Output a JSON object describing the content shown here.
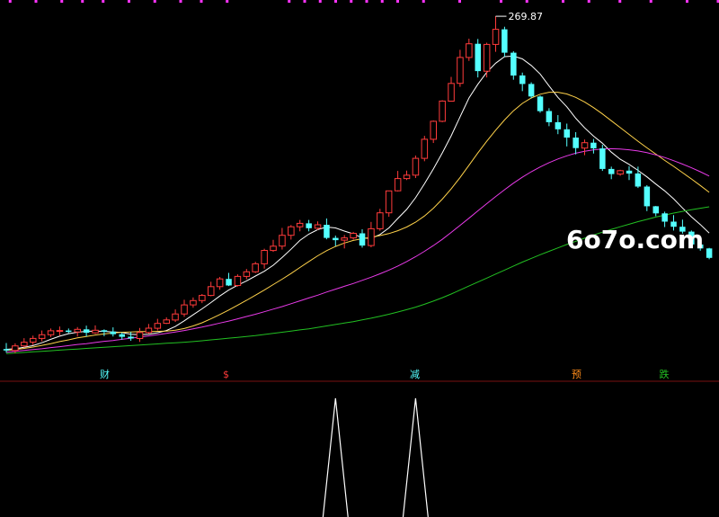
{
  "chart_data": {
    "type": "candlestick",
    "colors": {
      "up": "#ff3b3b",
      "down": "#54ffff",
      "background": "#000000",
      "ma5": "#ffffff",
      "ma10": "#ffd24a",
      "ma30": "#e83ae8",
      "ma60": "#22c022",
      "divider": "#7a1010",
      "top_markers": "#ff33ff",
      "indicator": "#ffffff"
    },
    "y_range": [
      150,
      274
    ],
    "peak": {
      "label": "269.87",
      "value": 269.87,
      "index": 55
    },
    "candles": [
      [
        153.1,
        152.6,
        155.2,
        151.8
      ],
      [
        152.6,
        154.2,
        155.1,
        151.7
      ],
      [
        154.2,
        155.5,
        156.9,
        153.7
      ],
      [
        155.5,
        156.8,
        157.8,
        154.5
      ],
      [
        156.8,
        158.1,
        159.6,
        155.8
      ],
      [
        158.1,
        159.5,
        160.3,
        157.3
      ],
      [
        159.5,
        159.6,
        161.0,
        157.9
      ],
      [
        159.6,
        159.1,
        160.3,
        158.7
      ],
      [
        159.1,
        160.0,
        160.8,
        157.5
      ],
      [
        160.0,
        158.8,
        161.3,
        157.5
      ],
      [
        158.8,
        159.7,
        161.4,
        158.4
      ],
      [
        159.7,
        159.2,
        160.0,
        157.6
      ],
      [
        159.2,
        158.3,
        160.7,
        157.5
      ],
      [
        158.3,
        157.4,
        158.9,
        156.4
      ],
      [
        157.4,
        156.8,
        159.1,
        156.0
      ],
      [
        156.8,
        158.9,
        160.5,
        155.6
      ],
      [
        158.9,
        160.4,
        161.9,
        158.4
      ],
      [
        160.4,
        162.1,
        163.7,
        159.6
      ],
      [
        162.1,
        163.3,
        164.2,
        161.9
      ],
      [
        163.3,
        165.4,
        167.0,
        162.6
      ],
      [
        165.4,
        168.6,
        170.4,
        164.4
      ],
      [
        168.6,
        170.1,
        171.2,
        167.6
      ],
      [
        170.1,
        171.9,
        172.4,
        169.2
      ],
      [
        171.9,
        175.0,
        176.7,
        171.6
      ],
      [
        175.0,
        177.7,
        178.4,
        173.9
      ],
      [
        177.7,
        175.4,
        179.8,
        175.2
      ],
      [
        175.4,
        178.6,
        179.3,
        175.0
      ],
      [
        178.6,
        180.2,
        181.2,
        177.6
      ],
      [
        180.2,
        183.0,
        183.7,
        179.8
      ],
      [
        183.0,
        187.7,
        188.3,
        181.3
      ],
      [
        187.7,
        189.2,
        191.4,
        187.2
      ],
      [
        189.2,
        193.0,
        195.6,
        188.0
      ],
      [
        193.0,
        196.0,
        196.6,
        191.5
      ],
      [
        196.0,
        197.2,
        198.4,
        194.4
      ],
      [
        197.2,
        195.5,
        198.4,
        194.4
      ],
      [
        195.5,
        196.7,
        197.9,
        194.9
      ],
      [
        196.7,
        192.1,
        198.9,
        191.6
      ],
      [
        192.1,
        191.3,
        192.9,
        189.2
      ],
      [
        191.3,
        192.1,
        193.1,
        188.4
      ],
      [
        192.1,
        193.7,
        194.2,
        191.5
      ],
      [
        193.7,
        189.4,
        195.1,
        188.7
      ],
      [
        189.4,
        195.3,
        197.7,
        188.8
      ],
      [
        195.3,
        200.9,
        202.3,
        194.6
      ],
      [
        200.9,
        208.6,
        208.7,
        199.5
      ],
      [
        208.6,
        212.9,
        215.6,
        208.4
      ],
      [
        212.9,
        214.1,
        215.7,
        212.4
      ],
      [
        214.1,
        220.0,
        221.0,
        213.1
      ],
      [
        220.0,
        226.7,
        227.9,
        219.0
      ],
      [
        226.7,
        233.0,
        233.3,
        225.4
      ],
      [
        233.0,
        240.1,
        240.4,
        232.7
      ],
      [
        240.1,
        246.3,
        248.6,
        240.1
      ],
      [
        246.3,
        255.4,
        258.1,
        245.1
      ],
      [
        255.4,
        260.2,
        262.0,
        254.2
      ],
      [
        260.2,
        250.6,
        261.9,
        248.4
      ],
      [
        250.6,
        260.0,
        260.6,
        248.4
      ],
      [
        260.0,
        265.3,
        269.9,
        257.4
      ],
      [
        265.3,
        257.1,
        266.2,
        255.7
      ],
      [
        257.1,
        249.1,
        257.6,
        247.6
      ],
      [
        249.1,
        246.1,
        250.1,
        243.6
      ],
      [
        246.1,
        241.7,
        246.7,
        241.1
      ],
      [
        241.7,
        236.6,
        242.1,
        236.0
      ],
      [
        236.6,
        232.7,
        237.6,
        231.3
      ],
      [
        232.7,
        230.2,
        235.2,
        228.5
      ],
      [
        230.2,
        227.3,
        232.2,
        224.2
      ],
      [
        227.3,
        223.6,
        229.2,
        221.4
      ],
      [
        223.6,
        225.5,
        226.6,
        221.1
      ],
      [
        225.5,
        223.5,
        226.8,
        221.7
      ],
      [
        223.5,
        216.3,
        224.8,
        215.6
      ],
      [
        216.3,
        214.5,
        217.1,
        212.7
      ],
      [
        214.5,
        215.7,
        216.0,
        213.9
      ],
      [
        215.7,
        214.7,
        217.3,
        212.4
      ],
      [
        214.7,
        210.1,
        217.1,
        209.6
      ],
      [
        210.1,
        203.2,
        210.6,
        201.5
      ],
      [
        203.2,
        200.7,
        203.3,
        199.7
      ],
      [
        200.7,
        197.8,
        201.3,
        195.9
      ],
      [
        197.8,
        196.0,
        200.1,
        194.7
      ],
      [
        196.0,
        194.3,
        198.5,
        193.6
      ],
      [
        194.3,
        189.8,
        194.7,
        188.7
      ],
      [
        189.8,
        188.4,
        191.7,
        187.6
      ],
      [
        188.4,
        185.1,
        188.6,
        184.6
      ]
    ],
    "ma_series": [
      {
        "key": "ma5",
        "values": [
          153.0,
          153.2,
          153.7,
          154.3,
          155.3,
          156.5,
          157.6,
          158.5,
          159.0,
          159.3,
          159.4,
          159.3,
          159.1,
          158.9,
          158.3,
          158.1,
          158.3,
          158.8,
          159.6,
          161.0,
          163.0,
          165.1,
          167.2,
          169.4,
          171.7,
          173.8,
          175.5,
          177.0,
          178.7,
          180.4,
          182.5,
          185.2,
          188.1,
          191.2,
          193.4,
          195.0,
          195.9,
          195.6,
          194.5,
          193.5,
          192.1,
          191.9,
          193.3,
          195.6,
          198.9,
          202.1,
          206.2,
          211.1,
          216.3,
          221.9,
          227.9,
          234.6,
          241.2,
          246.0,
          250.2,
          253.4,
          255.7,
          255.9,
          254.9,
          252.6,
          249.6,
          245.4,
          241.4,
          238.1,
          234.1,
          230.7,
          227.8,
          225.3,
          222.2,
          219.7,
          217.9,
          215.8,
          213.5,
          211.0,
          208.6,
          205.8,
          202.6,
          199.5,
          196.8,
          193.8
        ]
      },
      {
        "key": "ma10",
        "values": [
          152.6,
          152.9,
          153.3,
          153.8,
          154.4,
          155.0,
          155.7,
          156.3,
          157.0,
          157.5,
          158.0,
          158.4,
          158.7,
          159.0,
          159.1,
          159.2,
          159.2,
          159.3,
          159.4,
          159.7,
          160.3,
          161.2,
          162.3,
          163.7,
          165.2,
          166.8,
          168.5,
          170.2,
          172.0,
          173.8,
          175.7,
          177.6,
          179.6,
          181.7,
          183.8,
          185.8,
          187.6,
          189.1,
          190.3,
          191.2,
          191.8,
          192.3,
          192.9,
          193.6,
          194.6,
          195.9,
          197.6,
          199.8,
          202.5,
          205.7,
          209.3,
          213.3,
          217.6,
          221.9,
          226.0,
          229.9,
          233.5,
          236.7,
          239.3,
          241.2,
          242.5,
          243.2,
          243.2,
          242.6,
          241.4,
          239.8,
          237.8,
          235.6,
          233.2,
          230.8,
          228.4,
          226.0,
          223.7,
          221.5,
          219.3,
          217.2,
          215.0,
          212.8,
          210.5,
          208.1
        ]
      },
      {
        "key": "ma30",
        "values": [
          152.0,
          152.3,
          152.6,
          152.9,
          153.2,
          153.6,
          153.9,
          154.3,
          154.7,
          155.0,
          155.4,
          155.8,
          156.1,
          156.5,
          156.9,
          157.3,
          157.7,
          158.1,
          158.6,
          159.1,
          159.6,
          160.2,
          160.8,
          161.5,
          162.2,
          162.9,
          163.7,
          164.5,
          165.3,
          166.2,
          167.1,
          168.0,
          169.0,
          170.0,
          171.0,
          172.0,
          173.1,
          174.1,
          175.1,
          176.1,
          177.2,
          178.3,
          179.5,
          180.8,
          182.2,
          183.8,
          185.5,
          187.4,
          189.4,
          191.6,
          194.0,
          196.5,
          199.0,
          201.6,
          204.1,
          206.6,
          209.0,
          211.3,
          213.4,
          215.3,
          217.0,
          218.5,
          219.8,
          220.9,
          221.8,
          222.5,
          223.0,
          223.3,
          223.4,
          223.3,
          223.0,
          222.6,
          222.0,
          221.2,
          220.3,
          219.2,
          218.0,
          216.7,
          215.3,
          213.8
        ]
      },
      {
        "key": "ma60",
        "values": [
          151.5,
          151.7,
          151.9,
          152.1,
          152.3,
          152.5,
          152.7,
          152.9,
          153.1,
          153.3,
          153.5,
          153.7,
          153.9,
          154.1,
          154.3,
          154.5,
          154.7,
          154.9,
          155.1,
          155.3,
          155.5,
          155.7,
          156.0,
          156.3,
          156.6,
          156.9,
          157.2,
          157.5,
          157.8,
          158.2,
          158.6,
          159.0,
          159.4,
          159.8,
          160.2,
          160.7,
          161.2,
          161.7,
          162.2,
          162.7,
          163.3,
          163.9,
          164.6,
          165.3,
          166.1,
          166.9,
          167.8,
          168.8,
          169.9,
          171.1,
          172.4,
          173.8,
          175.2,
          176.6,
          178.0,
          179.4,
          180.8,
          182.2,
          183.6,
          184.9,
          186.2,
          187.4,
          188.6,
          189.8,
          190.9,
          192.0,
          193.1,
          194.1,
          195.1,
          196.0,
          196.9,
          197.8,
          198.6,
          199.4,
          200.1,
          200.8,
          201.4,
          202.0,
          202.5,
          203.0
        ]
      }
    ],
    "event_labels": [
      {
        "text": "财",
        "index": 15,
        "color": "#54ffff"
      },
      {
        "text": "$",
        "index": 33,
        "color": "#ff3b3b"
      },
      {
        "text": "减",
        "index": 61,
        "color": "#54ffff"
      },
      {
        "text": "预",
        "index": 85,
        "color": "#ff8c1a"
      },
      {
        "text": "跌",
        "index": 98,
        "color": "#22c022"
      }
    ],
    "top_marker_index_groups": [
      [
        1,
        6,
        11,
        15,
        19,
        24,
        29,
        34,
        38,
        43
      ],
      [
        55,
        58,
        61,
        64,
        67,
        70,
        73,
        76
      ],
      [
        81,
        88,
        96,
        101,
        108,
        113,
        119,
        125,
        132,
        138
      ]
    ],
    "indicator": {
      "type": "line",
      "spikes": [
        {
          "index": 37,
          "value": 1
        },
        {
          "index": 46,
          "value": 1
        }
      ],
      "half_width": 1.4
    }
  },
  "watermark": "6o7o.com"
}
